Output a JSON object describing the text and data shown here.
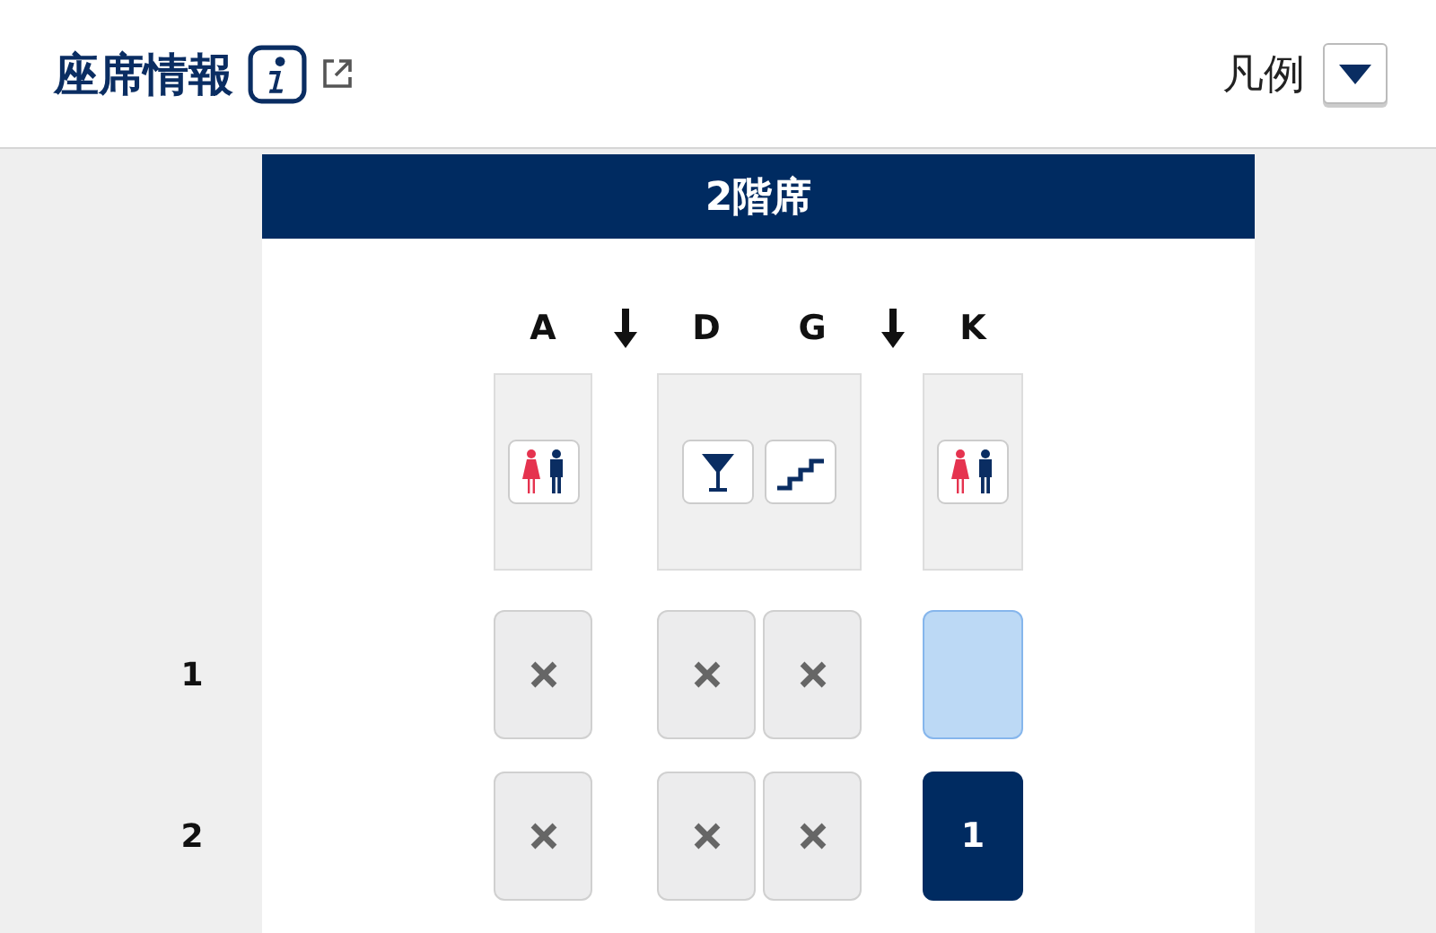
{
  "header": {
    "title": "座席情報",
    "legend_label": "凡例"
  },
  "deck": {
    "title": "2階席"
  },
  "columns": [
    {
      "kind": "seat",
      "label": "A"
    },
    {
      "kind": "aisle"
    },
    {
      "kind": "seat",
      "label": "D"
    },
    {
      "kind": "seat",
      "label": "G"
    },
    {
      "kind": "aisle"
    },
    {
      "kind": "seat",
      "label": "K"
    }
  ],
  "facilities": [
    {
      "items": [
        {
          "kind": "lavatory"
        }
      ]
    },
    {
      "items": [
        {
          "kind": "bar"
        },
        {
          "kind": "stairs"
        }
      ]
    },
    {
      "items": [
        {
          "kind": "lavatory"
        }
      ]
    }
  ],
  "rows": [
    {
      "number": "1",
      "seats": [
        {
          "occupied": true,
          "selected": false
        },
        {
          "occupied": true,
          "selected": false
        },
        {
          "occupied": true,
          "selected": false
        },
        {
          "occupied": false,
          "selected": false
        }
      ]
    },
    {
      "number": "2",
      "seats": [
        {
          "occupied": true,
          "selected": false
        },
        {
          "occupied": true,
          "selected": false
        },
        {
          "occupied": true,
          "selected": false
        },
        {
          "occupied": false,
          "selected": true,
          "label": "1"
        }
      ]
    }
  ]
}
